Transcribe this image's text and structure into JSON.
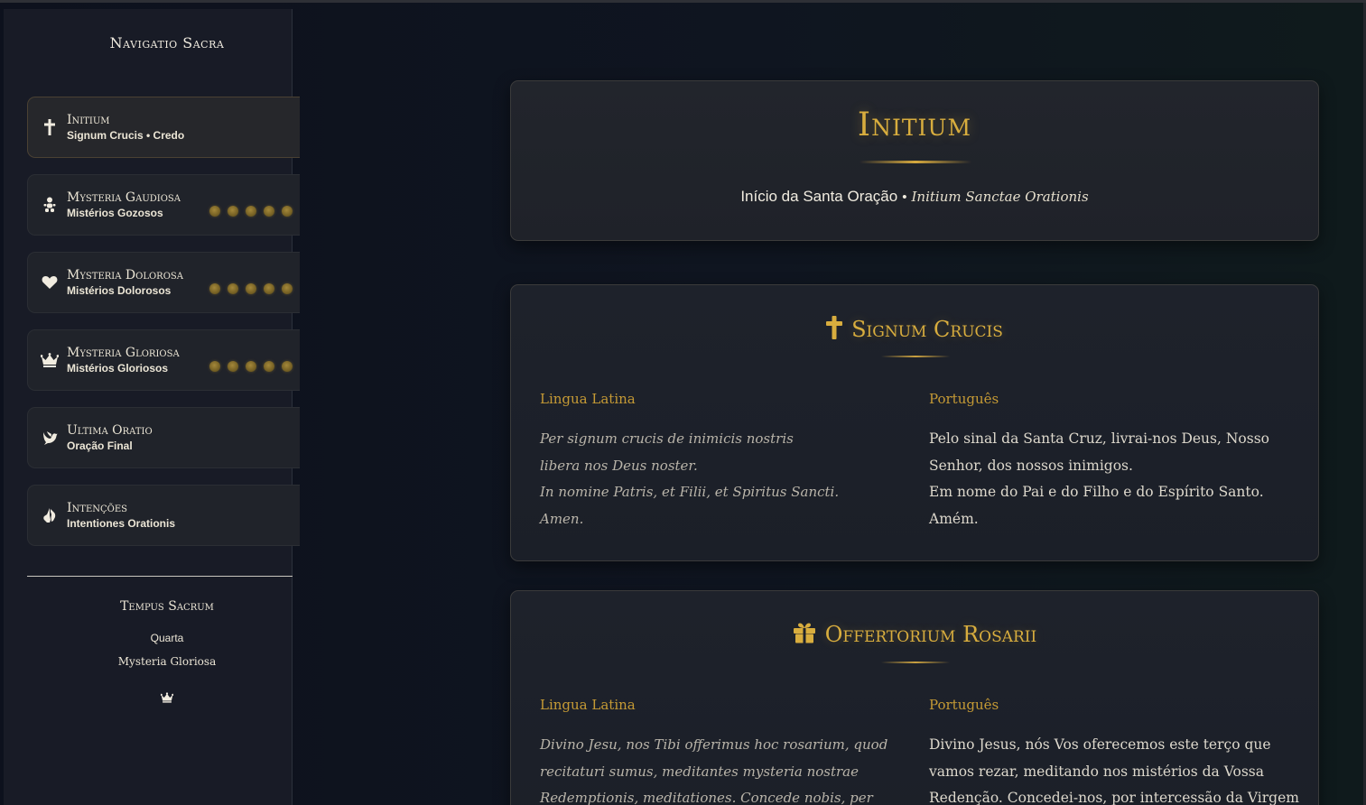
{
  "sidebar": {
    "title": "Navigatio Sacra",
    "items": [
      {
        "label": "Initium",
        "sub": "Signum Crucis • Credo",
        "icon": "cross-icon",
        "active": true
      },
      {
        "label": "Mysteria Gaudiosa",
        "sub": "Mistérios Gozosos",
        "icon": "child-icon",
        "decades": 5
      },
      {
        "label": "Mysteria Dolorosa",
        "sub": "Mistérios Dolorosos",
        "icon": "heart-icon",
        "decades": 5
      },
      {
        "label": "Mysteria Gloriosa",
        "sub": "Mistérios Gloriosos",
        "icon": "crown-icon",
        "decades": 5
      },
      {
        "label": "Ultima Oratio",
        "sub": "Oração Final",
        "icon": "dove-icon"
      },
      {
        "label": "Intenções",
        "sub": "Intentiones Orationis",
        "icon": "praying-hands-icon"
      }
    ],
    "tempus": {
      "title": "Tempus Sacrum",
      "day": "Quarta",
      "mystery": "Mysteria Gloriosa",
      "icon": "crown-icon"
    }
  },
  "header": {
    "title": "Initium",
    "subtitle_pt": "Início da Santa Oração",
    "separator": "•",
    "subtitle_la": "Initium Sanctae Orationis"
  },
  "prayers": [
    {
      "title": "Signum Crucis",
      "icon": "cross-icon",
      "latin_heading": "Lingua Latina",
      "portuguese_heading": "Português",
      "latin_lines": [
        "Per signum crucis de inimicis nostris",
        "libera nos Deus noster.",
        "In nomine Patris, et Filii, et Spiritus Sancti.",
        "Amen."
      ],
      "portuguese_lines": [
        "Pelo sinal da Santa Cruz, livrai-nos Deus, Nosso Senhor, dos nossos inimigos.",
        "Em nome do Pai e do Filho e do Espírito Santo.",
        "Amém."
      ]
    },
    {
      "title": "Offertorium Rosarii",
      "icon": "gift-icon",
      "latin_heading": "Lingua Latina",
      "portuguese_heading": "Português",
      "latin_lines": [
        "Divino Jesu, nos Tibi offerimus hoc rosarium, quod recitaturi sumus, meditantes mysteria nostrae Redemptionis, meditationes. Concede nobis, per intercessionem Virginis"
      ],
      "portuguese_lines": [
        "Divino Jesus, nós Vos oferecemos este terço que vamos rezar, meditando nos mistérios da Vossa Redenção. Concedei-nos, por intercessão da Virgem Maria, Mãe de"
      ]
    }
  ],
  "colors": {
    "gold": "#d8ad3e",
    "background": "#0f131c",
    "card": "#1e222b",
    "sidebar": "#181b26"
  }
}
